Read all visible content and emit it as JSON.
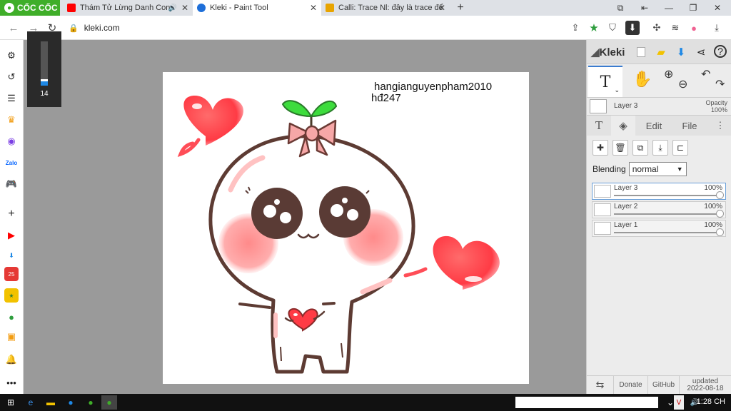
{
  "browser": {
    "brand": "CỐC CỐC",
    "tabs": [
      {
        "title": "Thám Tử Lừng Danh Con",
        "color": "#ff0000"
      },
      {
        "title": "Kleki - Paint Tool",
        "color": "#1e6fd9"
      },
      {
        "title": "Calli: Trace Nl: đây là trace để",
        "color": "#e8a400"
      }
    ],
    "url": "kleki.com"
  },
  "brush": {
    "size": "14",
    "level": 0.14
  },
  "canvas": {
    "signature_line1": "hangianguyenpham2010",
    "signature_line2": "hđ247"
  },
  "kleki": {
    "logo": "Kleki",
    "current_layer": "Layer 3",
    "opacity_label": "Opacity",
    "opacity_value": "100%",
    "tabs": {
      "edit": "Edit",
      "file": "File"
    },
    "blending_label": "Blending",
    "blending_value": "normal",
    "layers": [
      {
        "name": "Layer 3",
        "opacity": "100%"
      },
      {
        "name": "Layer 2",
        "opacity": "100%"
      },
      {
        "name": "Layer 1",
        "opacity": "100%"
      }
    ],
    "footer": {
      "donate": "Donate",
      "github": "GitHub",
      "updated": "updated",
      "date": "2022-08-18"
    }
  },
  "taskbar": {
    "time": "1:28 CH"
  },
  "colors": {
    "accent": "#3b7ccf",
    "brand_green": "#3fae29",
    "heart": "#ff4d57"
  }
}
